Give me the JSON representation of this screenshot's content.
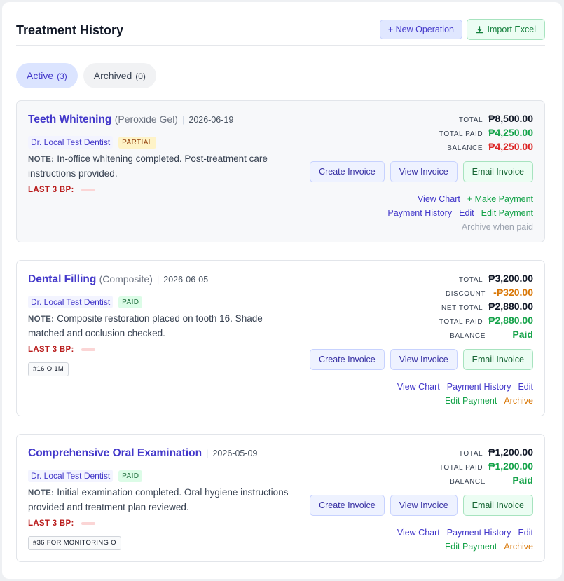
{
  "header": {
    "title": "Treatment History",
    "new_operation": "+ New Operation",
    "import_excel": "Import Excel"
  },
  "tabs": [
    {
      "label": "Active",
      "count": "(3)"
    },
    {
      "label": "Archived",
      "count": "(0)"
    }
  ],
  "labels": {
    "note": "NOTE:",
    "last_bp": "LAST 3 BP:",
    "total": "TOTAL",
    "discount": "DISCOUNT",
    "net_total": "NET TOTAL",
    "total_paid": "TOTAL PAID",
    "balance": "BALANCE",
    "create_invoice": "Create Invoice",
    "view_invoice": "View Invoice",
    "email_invoice": "Email Invoice",
    "view_chart": "View Chart",
    "make_payment": "+ Make Payment",
    "payment_history": "Payment History",
    "edit": "Edit",
    "edit_payment": "Edit Payment",
    "archive": "Archive",
    "archive_when_paid": "Archive when paid"
  },
  "records": [
    {
      "name": "Teeth Whitening",
      "sub": "(Peroxide Gel)",
      "date": "2026-06-19",
      "dentist": "Dr. Local Test Dentist",
      "status": "PARTIAL",
      "note": "In-office whitening completed. Post-treatment care instructions provided.",
      "total": "₱8,500.00",
      "total_paid": "₱4,250.00",
      "balance": "₱4,250.00"
    },
    {
      "name": "Dental Filling",
      "sub": "(Composite)",
      "date": "2026-06-05",
      "dentist": "Dr. Local Test Dentist",
      "status": "PAID",
      "note": "Composite restoration placed on tooth 16. Shade matched and occlusion checked.",
      "tooth_tag": "#16 O 1M",
      "total": "₱3,200.00",
      "discount": "-₱320.00",
      "net_total": "₱2,880.00",
      "total_paid": "₱2,880.00",
      "balance": "Paid"
    },
    {
      "name": "Comprehensive Oral Examination",
      "date": "2026-05-09",
      "dentist": "Dr. Local Test Dentist",
      "status": "PAID",
      "note": "Initial examination completed. Oral hygiene instructions provided and treatment plan reviewed.",
      "tooth_tag": "#36 FOR MONITORING O",
      "total": "₱1,200.00",
      "total_paid": "₱1,200.00",
      "balance": "Paid"
    }
  ],
  "colors": {
    "accent": "#4338ca",
    "paid_green": "#16a34a",
    "balance_red": "#dc2626",
    "discount_orange": "#d97706"
  },
  "icons": {
    "import": "download-icon"
  }
}
